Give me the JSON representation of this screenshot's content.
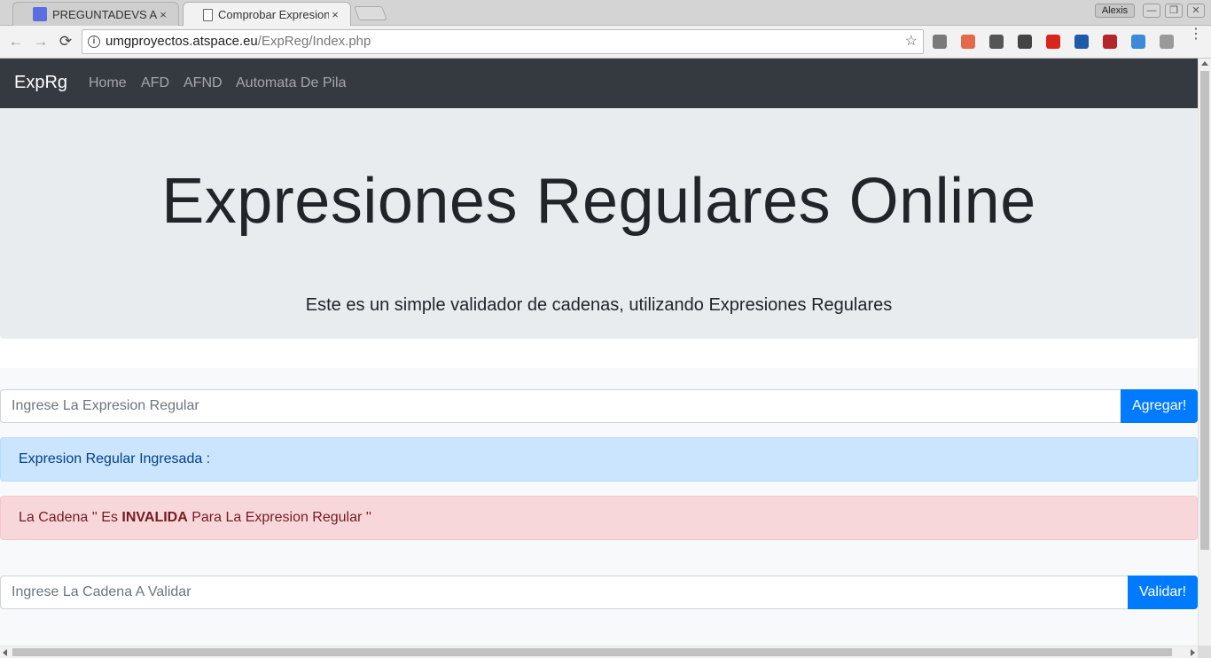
{
  "browser": {
    "tabs": [
      {
        "title": "PREGUNTADEVS APP",
        "close": "×"
      },
      {
        "title": "Comprobar Expresiones",
        "close": "×"
      }
    ],
    "user_name": "Alexis",
    "window_buttons": {
      "minimize": "—",
      "restore": "❐",
      "close": "✕"
    },
    "nav": {
      "back": "←",
      "forward": "→",
      "reload": "⟳"
    },
    "address": {
      "info_icon": "i",
      "host": "umgproyectos.atspace.eu",
      "path": "/ExpReg/Index.php",
      "star": "☆"
    },
    "extensions": [
      {
        "name": "extension-globe-icon",
        "color": "#7a7a7a"
      },
      {
        "name": "extension-calendar-icon",
        "color": "#e26a4a"
      },
      {
        "name": "extension-shield-icon",
        "color": "#555555"
      },
      {
        "name": "extension-speed-icon",
        "color": "#444444"
      },
      {
        "name": "extension-flag-icon",
        "color": "#d9261c"
      },
      {
        "name": "extension-chart-icon",
        "color": "#1e5aa8"
      },
      {
        "name": "extension-save-icon",
        "color": "#b3262b"
      },
      {
        "name": "extension-new-icon",
        "color": "#3c8ad8"
      },
      {
        "name": "extension-circle-icon",
        "color": "#999999"
      }
    ],
    "menu": "⋮"
  },
  "navbar": {
    "brand": "ExpRg",
    "links": [
      "Home",
      "AFD",
      "AFND",
      "Automata De Pila"
    ]
  },
  "jumbotron": {
    "title": "Expresiones Regulares Online",
    "subtitle": "Este es un simple validador de cadenas, utilizando Expresiones Regulares"
  },
  "regex_form": {
    "placeholder": "Ingrese La Expresion Regular",
    "button": "Agregar!"
  },
  "alert_info": {
    "text": "Expresion Regular Ingresada :"
  },
  "alert_danger": {
    "prefix": "La Cadena '' Es ",
    "strong": "INVALIDA",
    "suffix": " Para La Expresion Regular ''"
  },
  "string_form": {
    "placeholder": "Ingrese La Cadena A Validar",
    "button": "Validar!"
  },
  "colors": {
    "navbar_bg": "#343a40",
    "jumbotron_bg": "#e9ecef",
    "primary": "#007bff",
    "info_bg": "#cce5ff",
    "danger_bg": "#f8d7da"
  }
}
